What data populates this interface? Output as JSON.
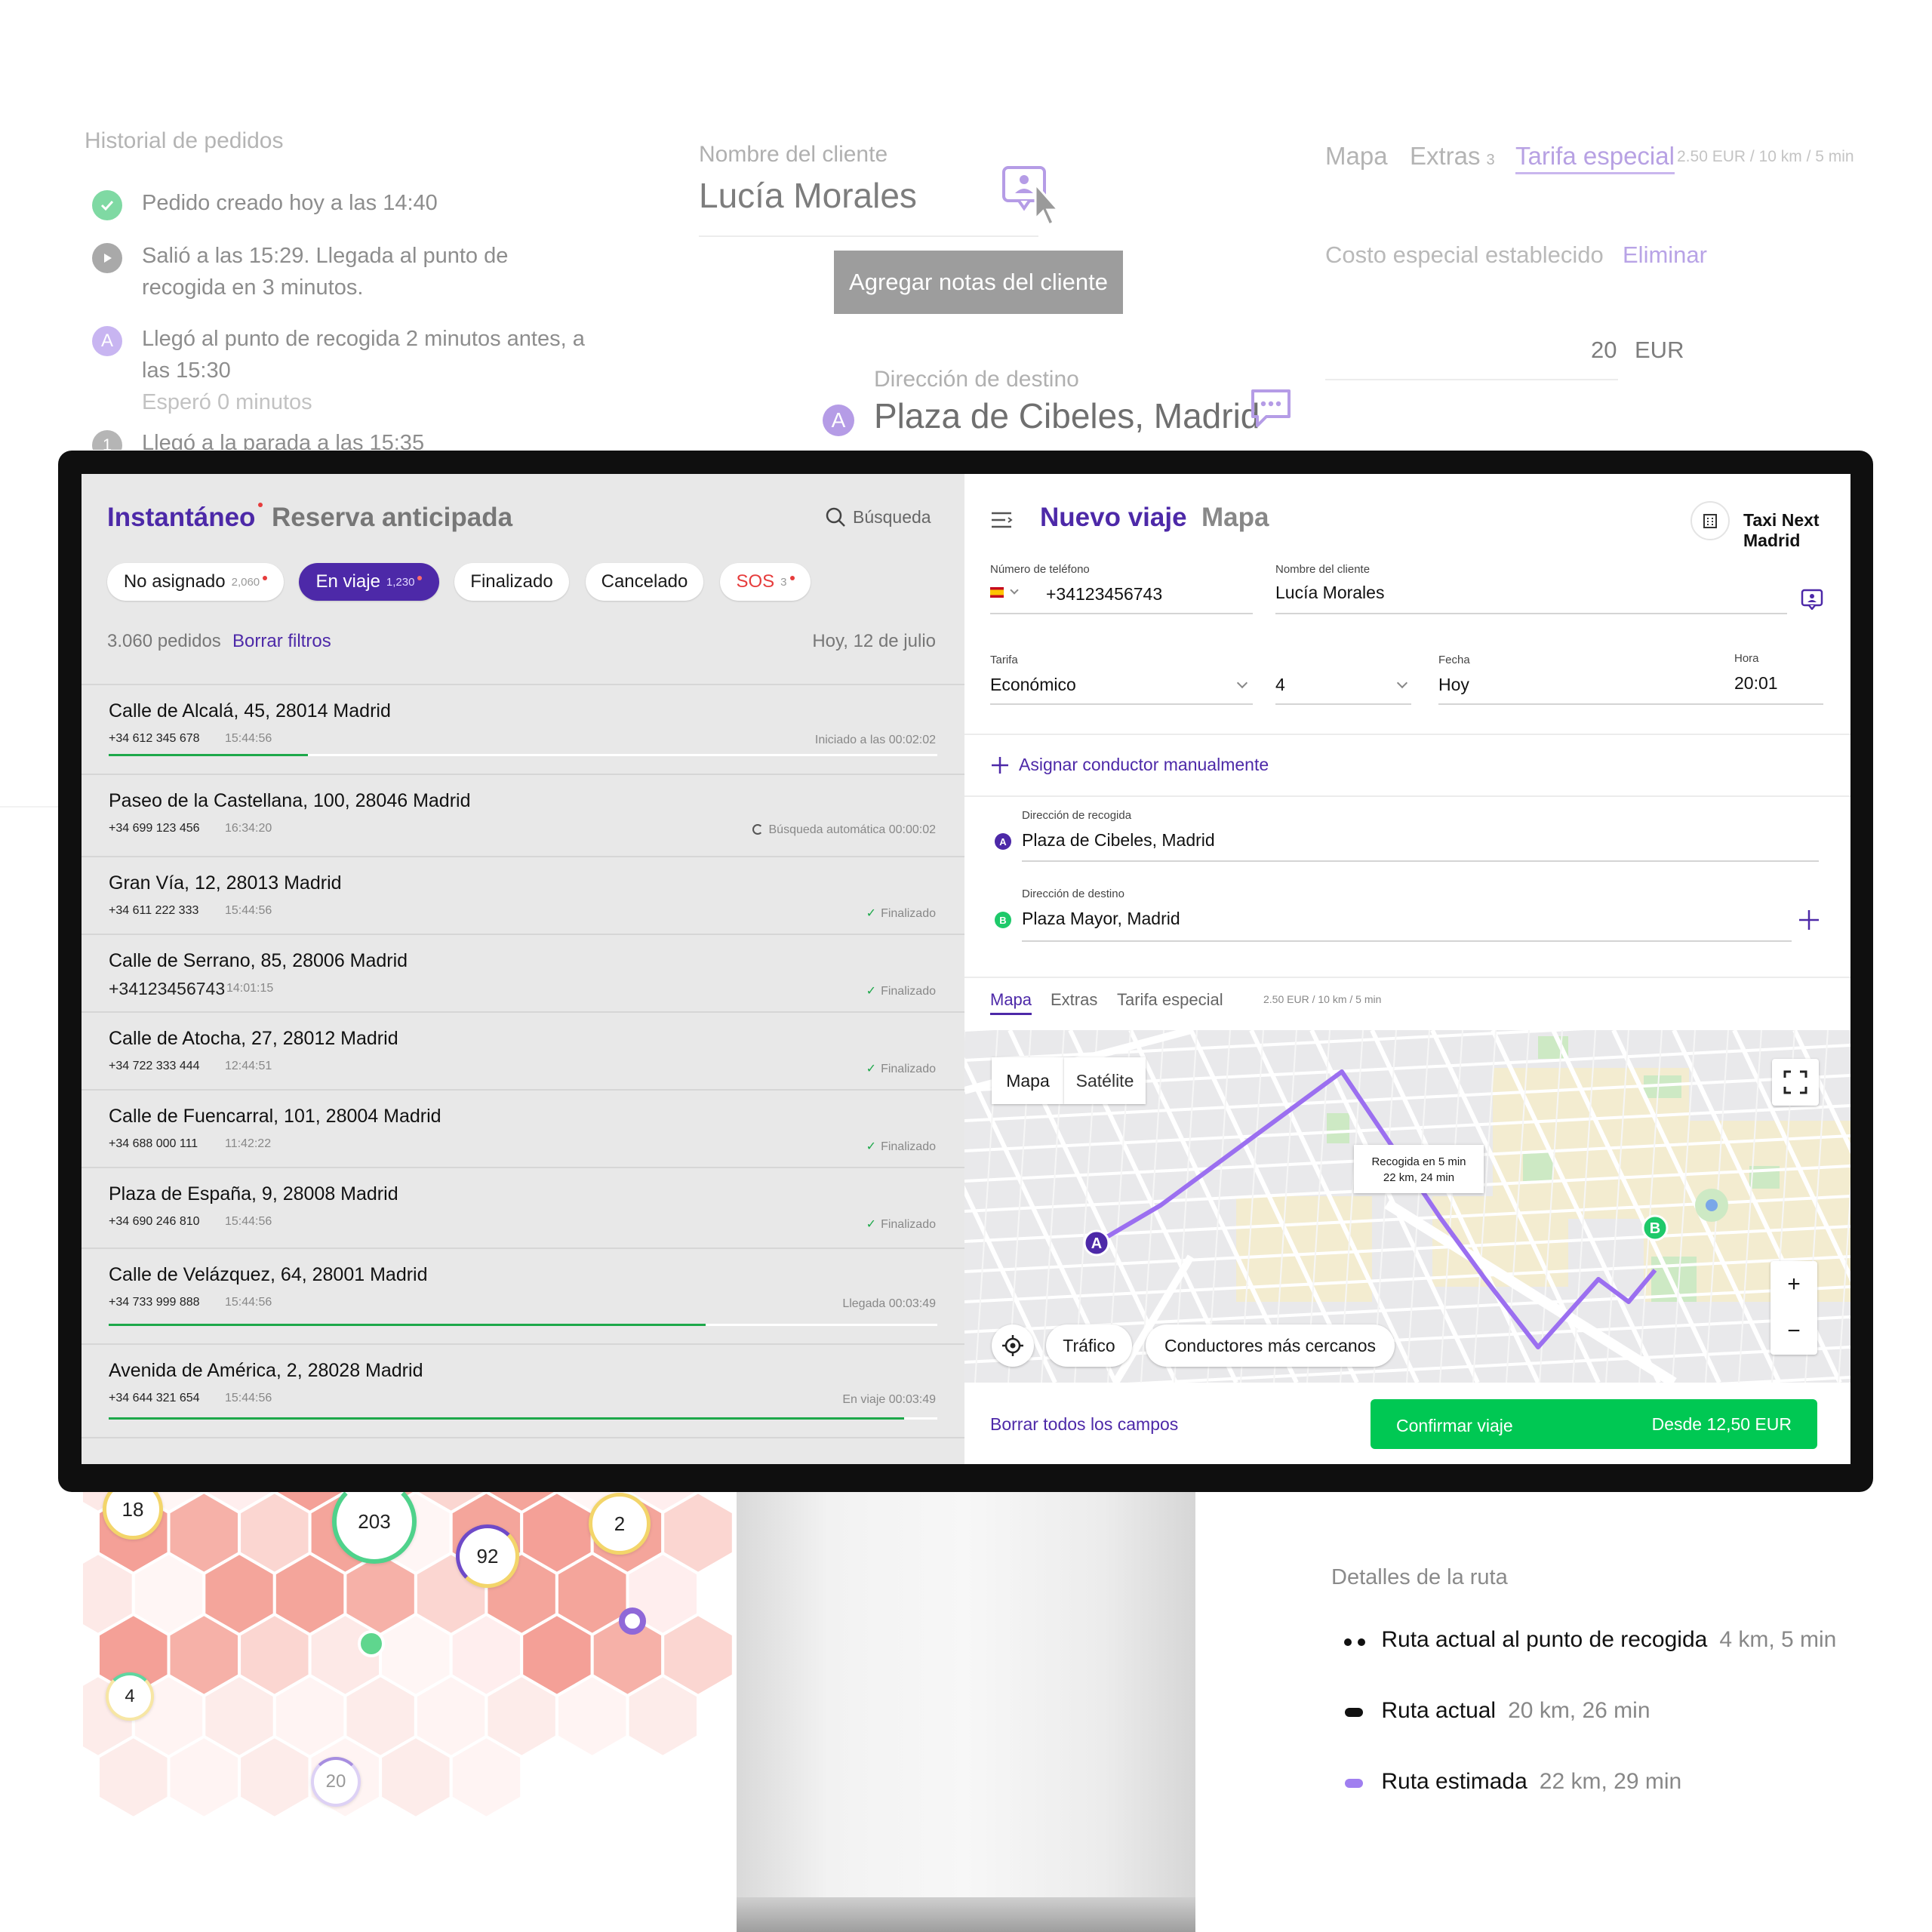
{
  "background": {
    "history": {
      "title": "Historial de pedidos",
      "items": [
        {
          "text": "Pedido creado hoy a las 14:40"
        },
        {
          "text": "Salió a las 15:29. Llegada al punto de recogida en 3 minutos."
        },
        {
          "text": "Llegó al punto de recogida 2 minutos antes, a las 15:30",
          "sub": "Esperó 0 minutos",
          "badge": "A"
        },
        {
          "text": "Llegó a la parada a las 15:35",
          "badge": "1"
        }
      ]
    },
    "client": {
      "label": "Nombre del cliente",
      "value": "Lucía Morales",
      "notes_button": "Agregar notas del cliente"
    },
    "destination": {
      "label": "Dirección de destino",
      "value": "Plaza de Cibeles, Madrid",
      "badge": "A"
    },
    "tabs": [
      "Mapa",
      "Extras",
      "Tarifa especial"
    ],
    "extras_count": "3",
    "tariff_note": "2.50 EUR / 10 km / 5 min",
    "special_cost": {
      "label": "Costo especial establecido",
      "remove": "Eliminar",
      "amount": "20",
      "currency": "EUR"
    },
    "route_details": {
      "title": "Detalles de la ruta",
      "rows": [
        {
          "label": "Ruta actual al punto de recogida",
          "value": "4 km, 5 min"
        },
        {
          "label": "Ruta actual",
          "value": "20 km, 26 min"
        },
        {
          "label": "Ruta estimada",
          "value": "22 km, 29 min"
        }
      ]
    },
    "heat_bubbles": [
      "18",
      "203",
      "92",
      "2",
      "4",
      "20"
    ]
  },
  "app": {
    "left": {
      "tabs": {
        "instant": "Instantáneo",
        "advance": "Reserva anticipada"
      },
      "search": "Búsqueda",
      "filters": [
        {
          "label": "No asignado",
          "count": "2,060"
        },
        {
          "label": "En viaje",
          "count": "1,230"
        },
        {
          "label": "Finalizado"
        },
        {
          "label": "Cancelado"
        },
        {
          "label": "SOS",
          "count": "3"
        }
      ],
      "orders_count": "3.060 pedidos",
      "clear_filters": "Borrar filtros",
      "date": "Hoy, 12 de julio",
      "orders": [
        {
          "address": "Calle de Alcalá, 45, 28014 Madrid",
          "phone": "+34 612 345 678",
          "time": "15:44:56",
          "status": "Iniciado a las 00:02:02",
          "progress": 0.24
        },
        {
          "address": "Paseo de la Castellana, 100, 28046 Madrid",
          "phone": "+34 699 123 456",
          "time": "16:34:20",
          "status": "Búsqueda automática 00:00:02"
        },
        {
          "address": "Gran Vía, 12, 28013 Madrid",
          "phone": "+34 611 222 333",
          "time": "15:44:56",
          "status": "Finalizado"
        },
        {
          "address": "Calle de Serrano, 85, 28006 Madrid",
          "phone": "+34123456743",
          "time": "14:01:15",
          "status": "Finalizado"
        },
        {
          "address": "Calle de Atocha, 27, 28012 Madrid",
          "phone": "+34 722 333 444",
          "time": "12:44:51",
          "status": "Finalizado"
        },
        {
          "address": "Calle de Fuencarral, 101, 28004 Madrid",
          "phone": "+34 688 000 111",
          "time": "11:42:22",
          "status": "Finalizado"
        },
        {
          "address": "Plaza de España, 9, 28008 Madrid",
          "phone": "+34 690 246 810",
          "time": "15:44:56",
          "status": "Finalizado"
        },
        {
          "address": "Calle de Velázquez, 64, 28001 Madrid",
          "phone": "+34 733 999 888",
          "time": "15:44:56",
          "status": "Llegada 00:03:49",
          "progress": 0.72
        },
        {
          "address": "Avenida de América, 2, 28028 Madrid",
          "phone": "+34 644 321 654",
          "time": "15:44:56",
          "status": "En viaje 00:03:49",
          "progress": 0.96
        }
      ]
    },
    "right": {
      "title": "Nuevo viaje",
      "map_tab": "Mapa",
      "company": "Taxi Next Madrid",
      "phone": {
        "label": "Número de teléfono",
        "value": "+34123456743"
      },
      "client": {
        "label": "Nombre del cliente",
        "value": "Lucía Morales"
      },
      "tariff": {
        "label": "Tarifa",
        "value": "Económico"
      },
      "seats": {
        "value": "4"
      },
      "date": {
        "label": "Fecha",
        "value": "Hoy"
      },
      "hour": {
        "label": "Hora",
        "value": "20:01"
      },
      "assign_driver": "Asignar conductor manualmente",
      "pickup": {
        "label": "Dirección de recogida",
        "value": "Plaza de Cibeles, Madrid",
        "badge": "A"
      },
      "dropoff": {
        "label": "Dirección de destino",
        "value": "Plaza Mayor, Madrid",
        "badge": "B"
      },
      "bottom_tabs": [
        "Mapa",
        "Extras",
        "Tarifa especial"
      ],
      "tariff_note": "2.50 EUR / 10 km / 5 min",
      "map": {
        "type_buttons": [
          "Mapa",
          "Satélite"
        ],
        "tooltip_line1": "Recogida en 5 min",
        "tooltip_line2": "22 km, 24 min",
        "traffic": "Tráfico",
        "nearest": "Conductores más cercanos",
        "zoom_in": "+",
        "zoom_out": "−"
      },
      "clear_all": "Borrar todos los campos",
      "confirm": "Confirmar viaje",
      "price": "Desde 12,50 EUR"
    }
  },
  "colors": {
    "accent_purple": "#4d29a8",
    "route_purple": "#9b6ff0",
    "confirm_green": "#00c853",
    "progress_green": "#1da84a",
    "sos_red": "#e63c3c"
  }
}
